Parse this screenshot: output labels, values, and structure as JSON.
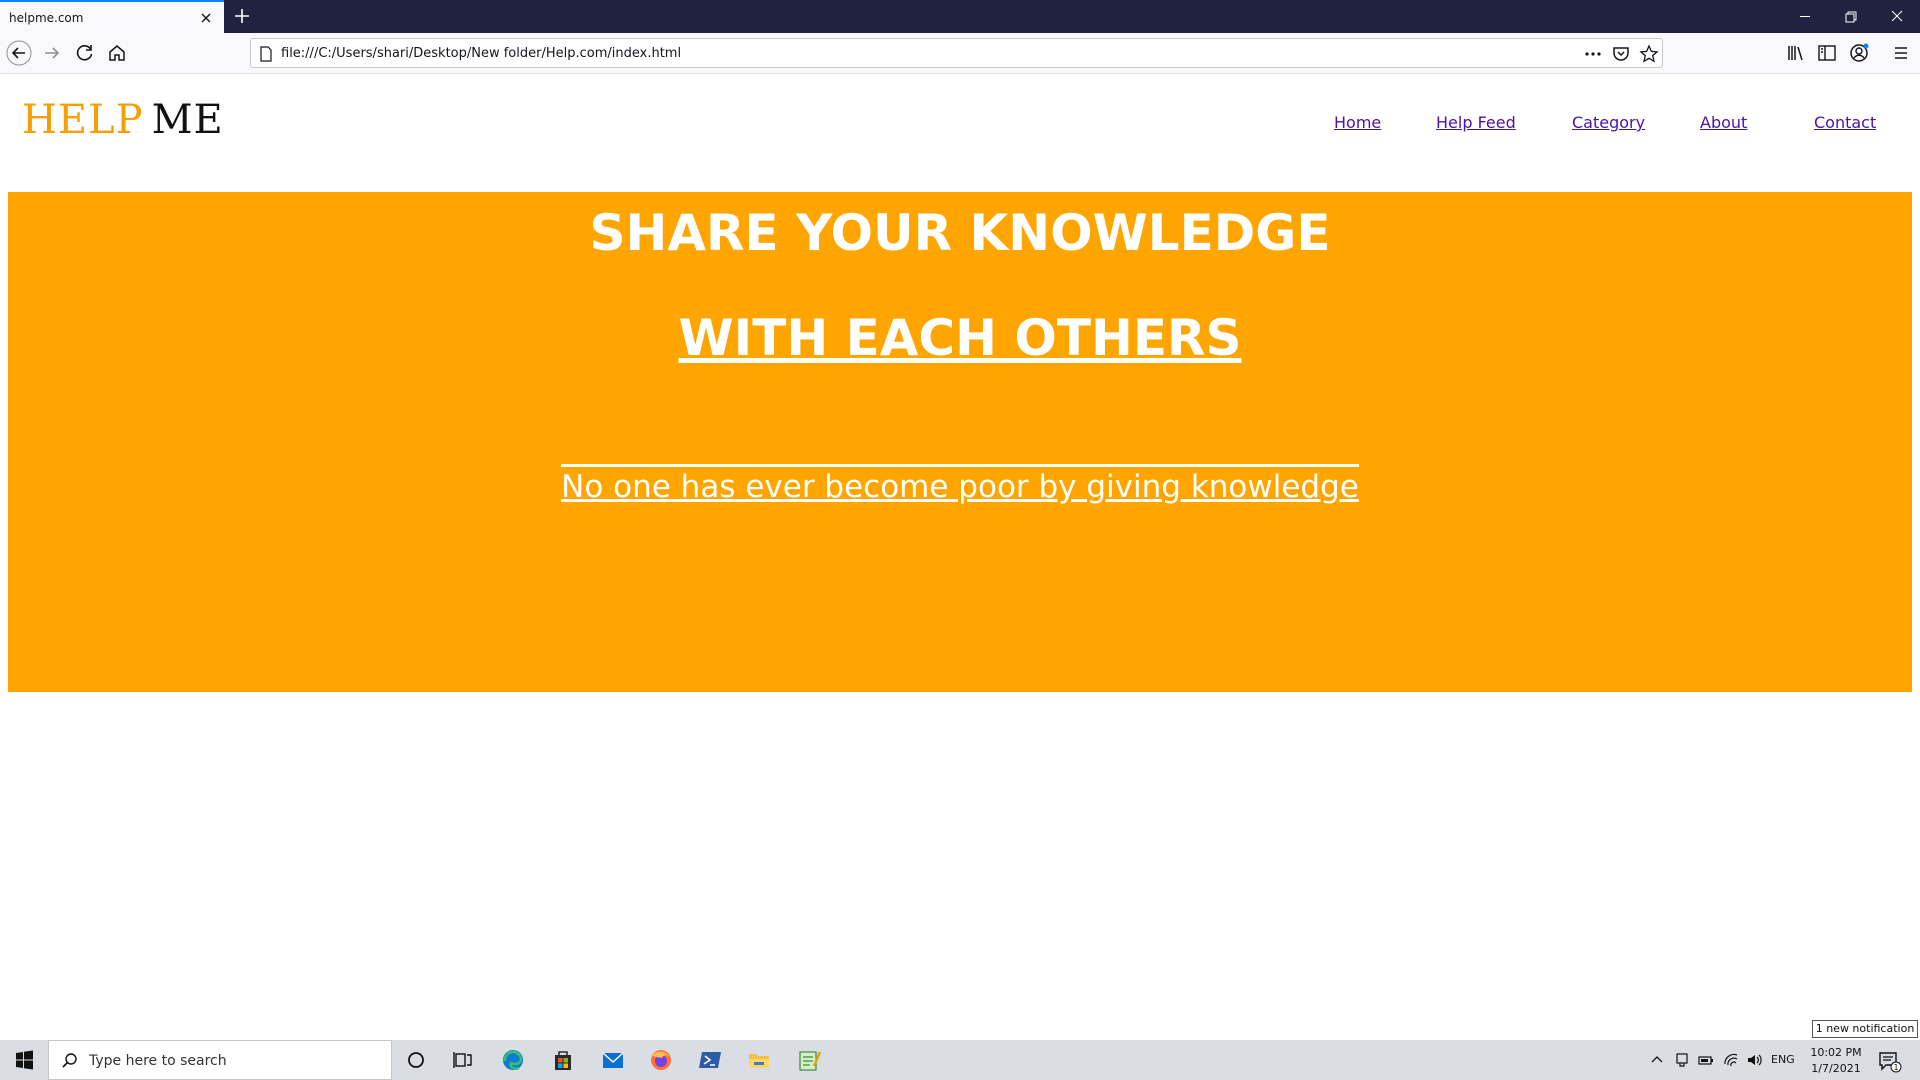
{
  "browser": {
    "tab_title": "helpme.com",
    "url": "file:///C:/Users/shari/Desktop/New folder/Help.com/index.html",
    "icons": [
      "close-icon",
      "plus-icon",
      "back-icon",
      "forward-icon",
      "reload-icon",
      "home-icon",
      "page-icon",
      "more-icon",
      "pocket-icon",
      "star-icon",
      "library-icon",
      "sidebar-icon",
      "account-icon",
      "menu-icon",
      "minimize-icon",
      "restore-icon",
      "window-close-icon"
    ]
  },
  "site": {
    "logo": {
      "part1": "HELP",
      "part2": "ME"
    },
    "nav": [
      {
        "label": "Home"
      },
      {
        "label": "Help Feed"
      },
      {
        "label": "Category"
      },
      {
        "label": "About"
      },
      {
        "label": "Contact"
      }
    ],
    "hero": {
      "title": "SHARE YOUR KNOWLEDGE",
      "subtitle": "WITH EACH OTHERS",
      "quote": "No one has ever become poor by giving knowledge"
    },
    "colors": {
      "hero_bg": "#ffa500",
      "logo_accent": "#f5a000",
      "nav_link": "#4b12a8"
    }
  },
  "notification": "1 new notification",
  "taskbar": {
    "search_placeholder": "Type here to search",
    "language": "ENG",
    "time": "10:02 PM",
    "date": "1/7/2021",
    "apps": [
      "cortana-icon",
      "task-view-icon",
      "edge-icon",
      "store-icon",
      "mail-icon",
      "firefox-icon",
      "powershell-icon",
      "file-explorer-icon",
      "notepad-icon"
    ]
  }
}
